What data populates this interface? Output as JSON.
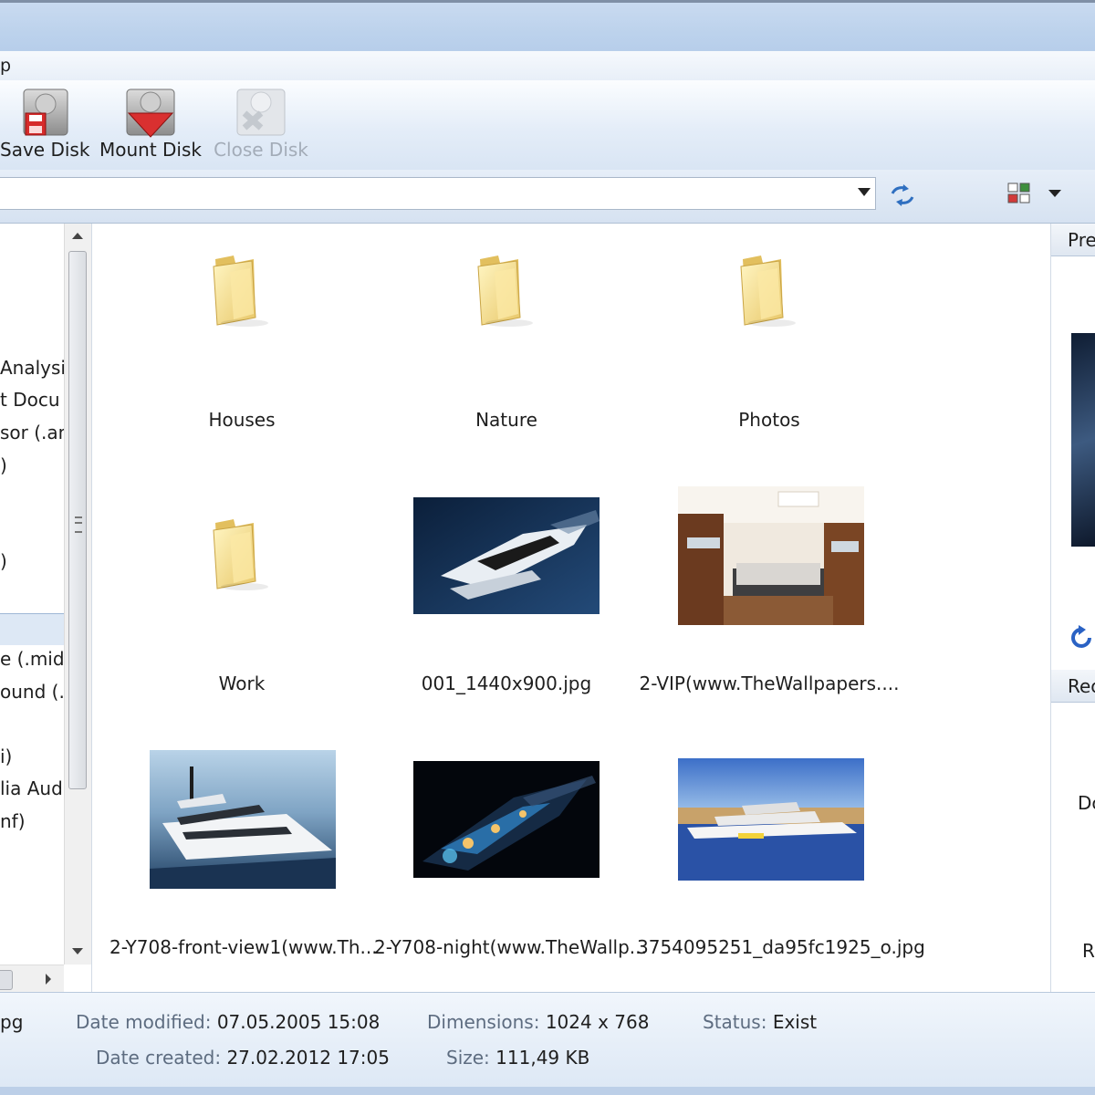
{
  "menubar": {
    "partial_item": "p"
  },
  "toolbar": {
    "buttons": [
      {
        "label": "Save Disk",
        "icon": "disk-save-icon",
        "enabled": true
      },
      {
        "label": "Mount Disk",
        "icon": "disk-mount-icon",
        "enabled": true
      },
      {
        "label": "Close Disk",
        "icon": "disk-close-icon",
        "enabled": false
      }
    ]
  },
  "address": {
    "value": ""
  },
  "tree": {
    "items": [
      "Analysi",
      "t Docu",
      "sor (.an",
      ")",
      ")",
      "e (.mid)",
      "ound (.",
      "i)",
      "lia Audi",
      "nf)"
    ]
  },
  "files": [
    {
      "name": "Houses",
      "type": "folder"
    },
    {
      "name": "Nature",
      "type": "folder"
    },
    {
      "name": "Photos",
      "type": "folder"
    },
    {
      "name": "Work",
      "type": "folder"
    },
    {
      "name": "001_1440x900.jpg",
      "type": "image"
    },
    {
      "name": "2-VIP(www.TheWallpapers....",
      "type": "image"
    },
    {
      "name": "2-Y708-front-view1(www.Th...",
      "type": "image"
    },
    {
      "name": "2-Y708-night(www.TheWallp...",
      "type": "image"
    },
    {
      "name": "3754095251_da95fc1925_o.jpg",
      "type": "image"
    }
  ],
  "preview_pane": {
    "header1": "Pre",
    "header2": "Rec",
    "item1": "Dc",
    "item2": "Re"
  },
  "status": {
    "filename_partial": "pg",
    "date_modified_label": "Date modified:",
    "date_modified": "07.05.2005 15:08",
    "date_created_label": "Date created:",
    "date_created": "27.02.2012 17:05",
    "dimensions_label": "Dimensions:",
    "dimensions": "1024 x 768",
    "size_label": "Size:",
    "size": "111,49 KB",
    "status_label": "Status:",
    "status": "Exist"
  }
}
